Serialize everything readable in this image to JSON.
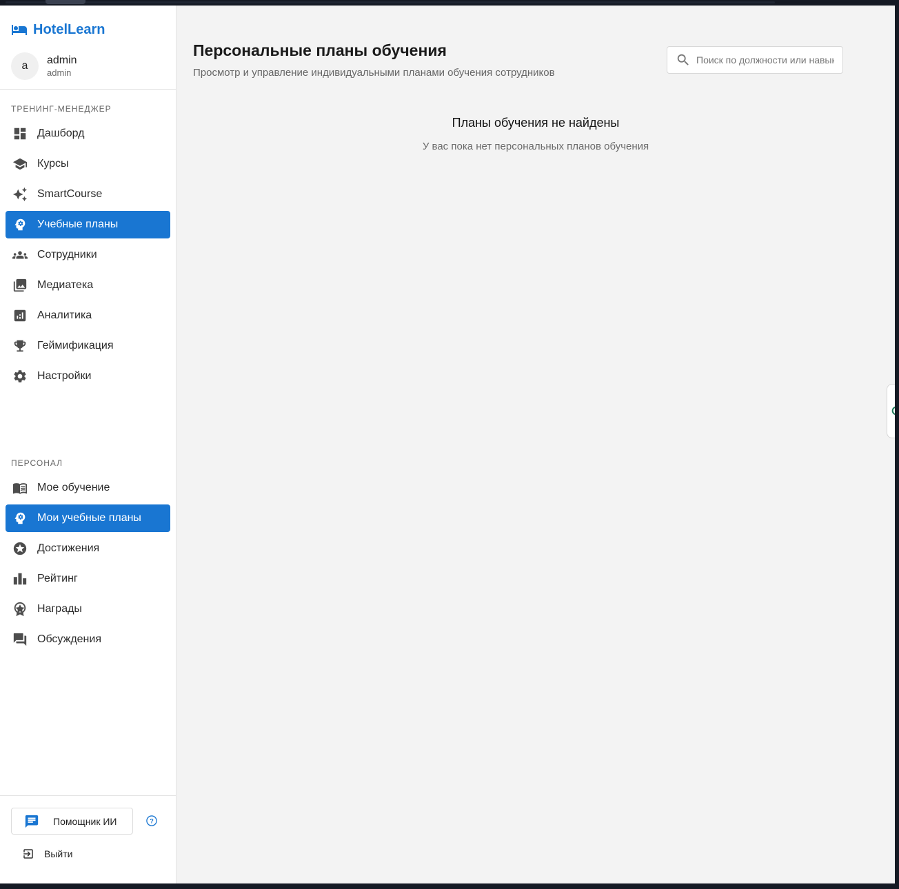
{
  "app": {
    "name": "HotelLearn",
    "brand_color": "#1976d2"
  },
  "user": {
    "avatar_letter": "a",
    "name": "admin",
    "role": "admin"
  },
  "sidebar": {
    "sections": [
      {
        "title": "ТРЕНИНГ-МЕНЕДЖЕР",
        "items": [
          {
            "label": "Дашборд",
            "icon": "dashboard-icon",
            "active": false
          },
          {
            "label": "Курсы",
            "icon": "school-icon",
            "active": false
          },
          {
            "label": "SmartCourse",
            "icon": "sparkle-icon",
            "active": false
          },
          {
            "label": "Учебные планы",
            "icon": "psychology-icon",
            "active": true
          },
          {
            "label": "Сотрудники",
            "icon": "people-icon",
            "active": false
          },
          {
            "label": "Медиатека",
            "icon": "photo-library-icon",
            "active": false
          },
          {
            "label": "Аналитика",
            "icon": "analytics-icon",
            "active": false
          },
          {
            "label": "Геймификация",
            "icon": "trophy-icon",
            "active": false
          },
          {
            "label": "Настройки",
            "icon": "gear-icon",
            "active": false
          }
        ]
      },
      {
        "title": "ПЕРСОНАЛ",
        "items": [
          {
            "label": "Мое обучение",
            "icon": "book-icon",
            "active": false
          },
          {
            "label": "Мои учебные планы",
            "icon": "psychology-icon",
            "active": true
          },
          {
            "label": "Достижения",
            "icon": "star-badge-icon",
            "active": false
          },
          {
            "label": "Рейтинг",
            "icon": "leaderboard-icon",
            "active": false
          },
          {
            "label": "Награды",
            "icon": "award-icon",
            "active": false
          },
          {
            "label": "Обсуждения",
            "icon": "forum-icon",
            "active": false
          }
        ]
      }
    ],
    "assistant_label": "Помощник ИИ",
    "logout_label": "Выйти"
  },
  "main": {
    "title": "Персональные планы обучения",
    "subtitle": "Просмотр и управление индивидуальными планами обучения сотрудников",
    "search": {
      "placeholder": "Поиск по должности или навыкам"
    },
    "empty": {
      "title": "Планы обучения не найдены",
      "subtitle": "У вас пока нет персональных планов обучения"
    }
  }
}
